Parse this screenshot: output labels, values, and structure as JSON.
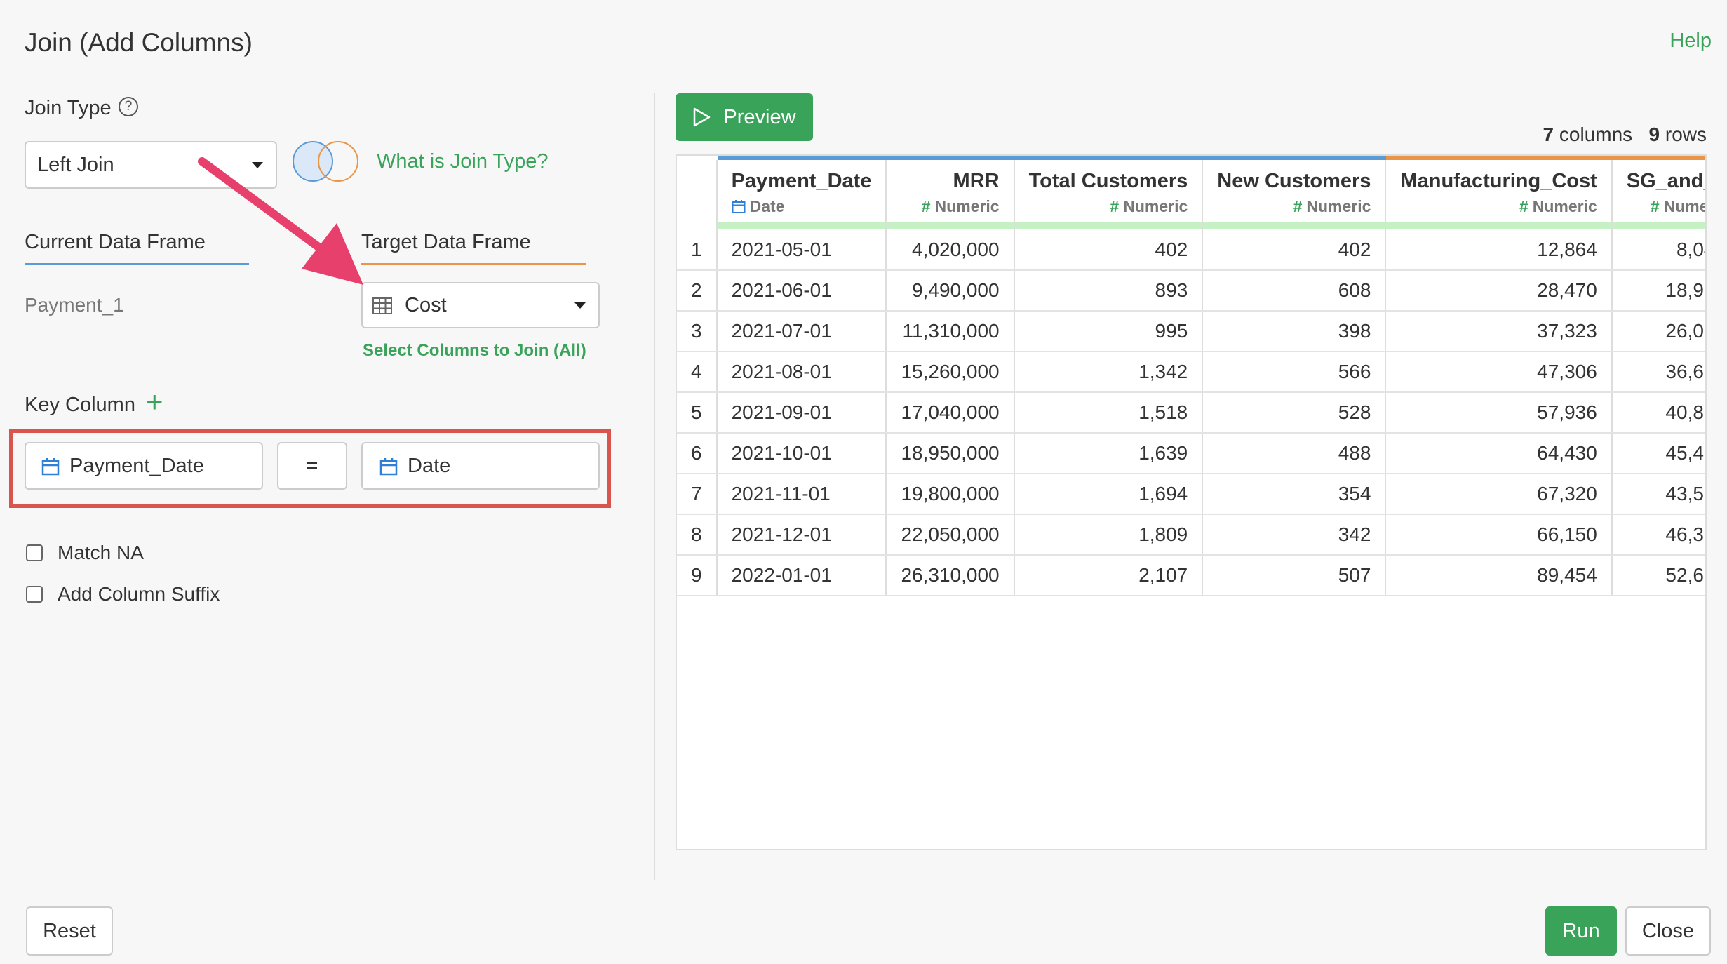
{
  "dialog": {
    "title": "Join (Add Columns)",
    "help_label": "Help"
  },
  "join_type": {
    "label": "Join Type",
    "help_glyph": "?",
    "selected": "Left Join",
    "info_link": "What is Join Type?"
  },
  "frames": {
    "current_label": "Current Data Frame",
    "current_value": "Payment_1",
    "target_label": "Target Data Frame",
    "target_value": "Cost",
    "select_columns_link": "Select Columns to Join (All)"
  },
  "key_column": {
    "label": "Key Column",
    "add_glyph": "+",
    "left_column": "Payment_Date",
    "operator": "=",
    "right_column": "Date"
  },
  "options": {
    "match_na": "Match NA",
    "add_suffix": "Add Column Suffix"
  },
  "preview": {
    "button_label": "Preview",
    "summary_columns_count": "7",
    "summary_columns_word": "columns",
    "summary_rows_count": "9",
    "summary_rows_word": "rows"
  },
  "table": {
    "columns": [
      {
        "name": "Payment_Date",
        "type": "Date",
        "accent": "#5b9bd5"
      },
      {
        "name": "MRR",
        "type": "Numeric",
        "accent": "#5b9bd5"
      },
      {
        "name": "Total Customers",
        "type": "Numeric",
        "accent": "#5b9bd5"
      },
      {
        "name": "New Customers",
        "type": "Numeric",
        "accent": "#5b9bd5"
      },
      {
        "name": "Manufacturing_Cost",
        "type": "Numeric",
        "accent": "#e8954a"
      },
      {
        "name": "SG_and_",
        "type": "Numer",
        "accent": "#e8954a"
      }
    ],
    "rows": [
      [
        "1",
        "2021-05-01",
        "4,020,000",
        "402",
        "402",
        "12,864",
        "8,04"
      ],
      [
        "2",
        "2021-06-01",
        "9,490,000",
        "893",
        "608",
        "28,470",
        "18,98"
      ],
      [
        "3",
        "2021-07-01",
        "11,310,000",
        "995",
        "398",
        "37,323",
        "26,01"
      ],
      [
        "4",
        "2021-08-01",
        "15,260,000",
        "1,342",
        "566",
        "47,306",
        "36,62"
      ],
      [
        "5",
        "2021-09-01",
        "17,040,000",
        "1,518",
        "528",
        "57,936",
        "40,89"
      ],
      [
        "6",
        "2021-10-01",
        "18,950,000",
        "1,639",
        "488",
        "64,430",
        "45,48"
      ],
      [
        "7",
        "2021-11-01",
        "19,800,000",
        "1,694",
        "354",
        "67,320",
        "43,56"
      ],
      [
        "8",
        "2021-12-01",
        "22,050,000",
        "1,809",
        "342",
        "66,150",
        "46,30"
      ],
      [
        "9",
        "2022-01-01",
        "26,310,000",
        "2,107",
        "507",
        "89,454",
        "52,62"
      ]
    ]
  },
  "footer": {
    "reset_label": "Reset",
    "run_label": "Run",
    "close_label": "Close"
  },
  "colors": {
    "accent_green": "#3aa35a",
    "current_frame_blue": "#5b9bd5",
    "target_frame_orange": "#e8954a",
    "highlight_red": "#d9534f",
    "arrow_pink": "#e8406c"
  }
}
